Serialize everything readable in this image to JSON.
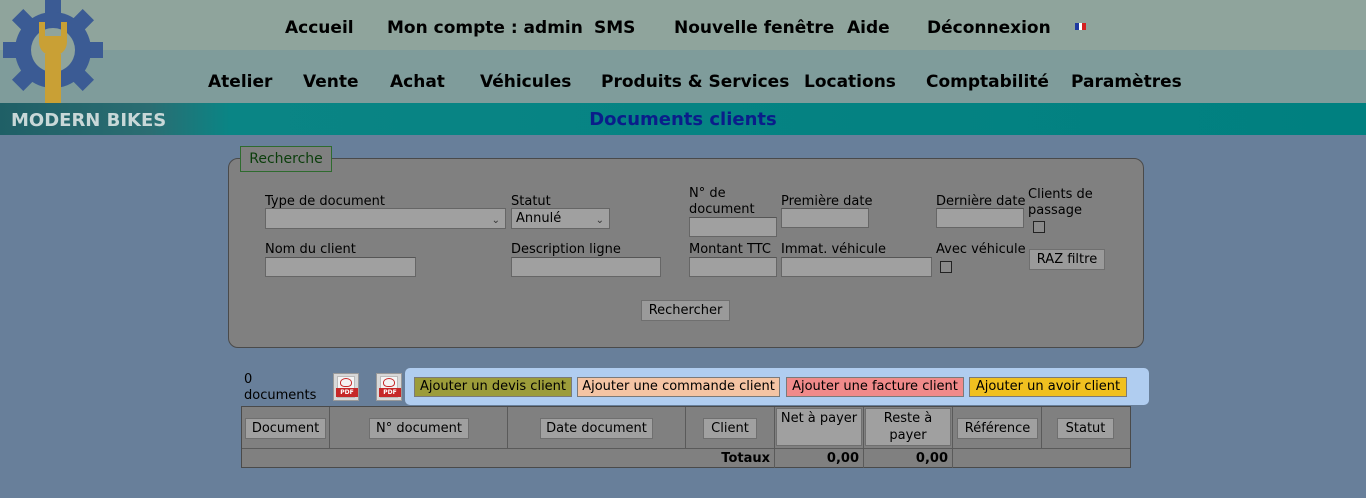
{
  "app": {
    "brand": "MODERN BIKES",
    "page_title": "Documents clients"
  },
  "top_nav": [
    "Accueil",
    "Mon compte : admin",
    "SMS",
    "Nouvelle fenêtre",
    "Aide",
    "Déconnexion"
  ],
  "main_nav": [
    "Atelier",
    "Vente",
    "Achat",
    "Véhicules",
    "Produits & Services",
    "Locations",
    "Comptabilité",
    "Paramètres"
  ],
  "language_flag_colors": [
    "#1f3aa0",
    "#ffffff",
    "#d42020"
  ],
  "search": {
    "legend": "Recherche",
    "type_document": {
      "label": "Type de document",
      "value": ""
    },
    "statut": {
      "label": "Statut",
      "value": "Annulé"
    },
    "num_document": {
      "label": "N° de document"
    },
    "premiere_date": {
      "label": "Première date"
    },
    "derniere_date": {
      "label": "Dernière date"
    },
    "clients_passage": {
      "label": "Clients de passage"
    },
    "nom_client": {
      "label": "Nom du client"
    },
    "description_ligne": {
      "label": "Description ligne"
    },
    "montant_ttc": {
      "label": "Montant TTC"
    },
    "immat_vehicule": {
      "label": "Immat. véhicule"
    },
    "avec_vehicule": {
      "label": "Avec véhicule"
    },
    "raz_button": "RAZ filtre",
    "search_button": "Rechercher"
  },
  "documents": {
    "count_label": "0 documents",
    "pdf_icons": [
      "pdf-icon",
      "pdf-icon"
    ]
  },
  "actions": [
    {
      "label": "Ajouter un devis client",
      "color": "#9c9c3a"
    },
    {
      "label": "Ajouter une commande client",
      "color": "#f4c4a4"
    },
    {
      "label": "Ajouter une facture client",
      "color": "#f08a8a"
    },
    {
      "label": "Ajouter un avoir client",
      "color": "#f0c020"
    }
  ],
  "table": {
    "columns": [
      "Document",
      "N° document",
      "Date document",
      "Client",
      "Net à payer",
      "Reste à payer",
      "Référence",
      "Statut"
    ],
    "totals_label": "Totaux",
    "total_net": "0,00",
    "total_reste": "0,00"
  }
}
